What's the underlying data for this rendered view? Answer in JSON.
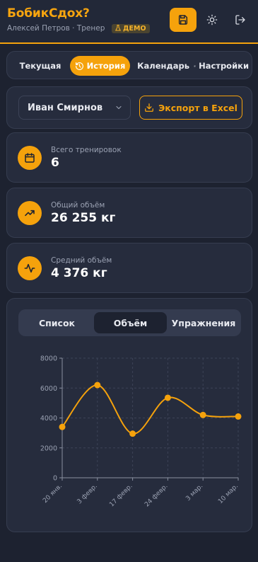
{
  "header": {
    "title": "БобикСдох?",
    "user": "Алексей Петров · Тренер",
    "demo_badge": "ДЕМО",
    "icons": [
      "save-icon",
      "sun-icon",
      "logout-icon"
    ]
  },
  "tabs": [
    {
      "label": "Текущая",
      "icon": "",
      "active": false
    },
    {
      "label": "История",
      "icon": "history-icon",
      "active": true
    },
    {
      "label": "Календарь",
      "icon": "calendar-icon",
      "active": false
    },
    {
      "label": "Настройки",
      "icon": "gear-icon",
      "active": false
    }
  ],
  "selector": {
    "athlete": "Иван Смирнов",
    "export_label": "Экспорт в Excel"
  },
  "stats": [
    {
      "label": "Всего тренировок",
      "value": "6",
      "icon": "calendar-icon"
    },
    {
      "label": "Общий объём",
      "value": "26 255 кг",
      "icon": "trending-up-icon"
    },
    {
      "label": "Средний объём",
      "value": "4 376 кг",
      "icon": "activity-icon"
    }
  ],
  "subtabs": [
    {
      "label": "Список",
      "active": false
    },
    {
      "label": "Объём",
      "active": true
    },
    {
      "label": "Упражнения",
      "active": false
    }
  ],
  "colors": {
    "accent": "#f5a20c",
    "background": "#1d2230",
    "card": "#262c3d"
  },
  "chart_data": {
    "type": "line",
    "categories": [
      "20 янв.",
      "3 февр.",
      "17 февр.",
      "24 февр.",
      "3 мар.",
      "10 мар."
    ],
    "points": [
      {
        "x": "20 янв.",
        "y": 3400
      },
      {
        "x": "3 февр.",
        "y": 6200
      },
      {
        "x": "17 февр.",
        "y": 2950
      },
      {
        "x": "24 февр.",
        "y": 5350
      },
      {
        "x": "3 мар.",
        "y": 4200
      },
      {
        "x": "10 мар.",
        "y": 4100
      }
    ],
    "yticks": [
      0,
      2000,
      4000,
      6000,
      8000
    ],
    "ylim": [
      0,
      8000
    ],
    "grid": true,
    "color": "#f5a20c"
  }
}
